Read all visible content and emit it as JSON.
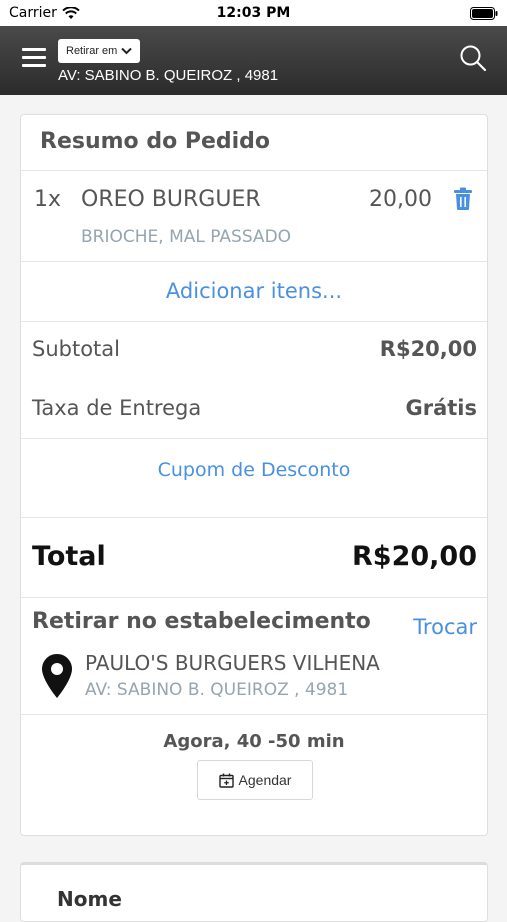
{
  "status_bar": {
    "carrier": "Carrier",
    "time": "12:03 PM"
  },
  "header": {
    "pickup_select": "Retirar em",
    "address": "AV: SABINO B. QUEIROZ , 4981",
    "icons": {
      "menu": "hamburger-menu-icon",
      "search": "search-icon",
      "chevron": "chevron-down-icon"
    }
  },
  "summary": {
    "title": "Resumo do Pedido",
    "items": [
      {
        "qty": "1x",
        "name": "OREO BURGUER",
        "price": "20,00",
        "options": "BRIOCHE, MAL PASSADO"
      }
    ],
    "add_items": "Adicionar itens...",
    "subtotal_label": "Subtotal",
    "subtotal_value": "R$20,00",
    "delivery_label": "Taxa de Entrega",
    "delivery_value": "Grátis",
    "coupon": "Cupom de Desconto",
    "total_label": "Total",
    "total_value": "R$20,00"
  },
  "pickup": {
    "title": "Retirar no estabelecimento",
    "change": "Trocar",
    "store_name": "PAULO'S BURGUERS VILHENA",
    "store_address": "AV: SABINO B. QUEIROZ , 4981",
    "eta": "Agora, 40 -50 min",
    "schedule": "Agendar"
  },
  "form": {
    "name_label": "Nome"
  },
  "colors": {
    "accent": "#4a90e2",
    "header_bg": "#2b2b2b",
    "muted": "#95a5b0"
  }
}
